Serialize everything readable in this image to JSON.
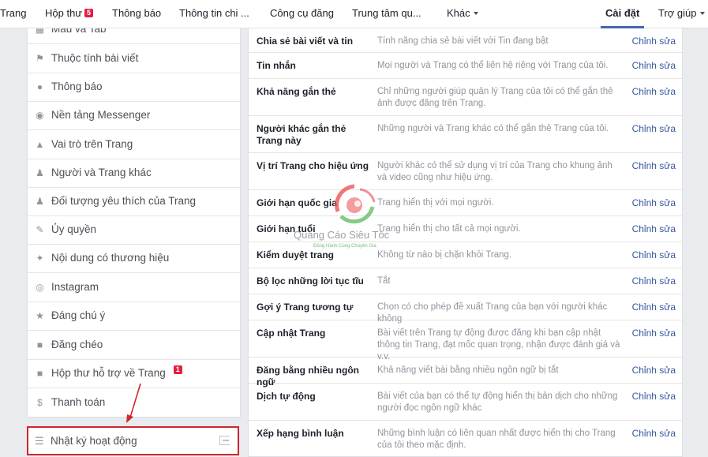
{
  "topnav": {
    "items": [
      {
        "label": "Trang"
      },
      {
        "label": "Hộp thư",
        "badge": "5"
      },
      {
        "label": "Thông báo"
      },
      {
        "label": "Thông tin chi ..."
      },
      {
        "label": "Công cụ đăng"
      },
      {
        "label": "Trung tâm qu..."
      },
      {
        "label": "Khác"
      },
      {
        "label": "Cài đặt"
      },
      {
        "label": "Trợ giúp"
      }
    ]
  },
  "sidebar": {
    "items": [
      {
        "label": "Mẫu và Tab",
        "icon": "grid-icon"
      },
      {
        "label": "Thuộc tính bài viết",
        "icon": "flag-icon"
      },
      {
        "label": "Thông báo",
        "icon": "globe-icon"
      },
      {
        "label": "Nền tảng Messenger",
        "icon": "messenger-icon"
      },
      {
        "label": "Vai trò trên Trang",
        "icon": "person-icon"
      },
      {
        "label": "Người và Trang khác",
        "icon": "people-star-icon"
      },
      {
        "label": "Đối tượng yêu thích của Trang",
        "icon": "people-star-icon"
      },
      {
        "label": "Ủy quyền",
        "icon": "wrench-icon"
      },
      {
        "label": "Nội dung có thương hiệu",
        "icon": "handshake-icon"
      },
      {
        "label": "Instagram",
        "icon": "instagram-icon"
      },
      {
        "label": "Đáng chú ý",
        "icon": "star-icon"
      },
      {
        "label": "Đăng chéo",
        "icon": "video-icon"
      },
      {
        "label": "Hộp thư hỗ trợ về Trang",
        "icon": "facebook-icon",
        "badge": "1"
      },
      {
        "label": "Thanh toán",
        "icon": "dollar-icon"
      }
    ],
    "activity_log": {
      "label": "Nhật ký hoạt động",
      "icon": "list-icon"
    }
  },
  "settings": {
    "edit_label": "Chỉnh sửa",
    "rows": [
      {
        "name": "Chia sẻ bài viết và tin",
        "desc": "Tính năng chia sẻ bài viết với Tin đang bật"
      },
      {
        "name": "Tin nhắn",
        "desc": "Mọi người và Trang có thể liên hệ riêng với Trang của tôi."
      },
      {
        "name": "Khả năng gắn thẻ",
        "desc": "Chỉ những người giúp quản lý Trang của tôi có thể gắn thẻ ảnh được đăng trên Trang."
      },
      {
        "name": "Người khác gắn thẻ Trang này",
        "desc": "Những người và Trang khác có thể gắn thẻ Trang của tôi."
      },
      {
        "name": "Vị trí Trang cho hiệu ứng",
        "desc": "Người khác có thể sử dụng vị trí của Trang cho khung ảnh và video cũng như hiệu ứng."
      },
      {
        "name": "Giới hạn quốc gia",
        "desc": "Trang hiển thị với mọi người."
      },
      {
        "name": "Giới hạn tuổi",
        "desc": "Trang hiển thị cho tất cả mọi người."
      },
      {
        "name": "Kiểm duyệt trang",
        "desc": "Không từ nào bị chặn khỏi Trang."
      },
      {
        "name": "Bộ lọc những lời tục tĩu",
        "desc": "Tắt"
      },
      {
        "name": "Gợi ý Trang tương tự",
        "desc": "Chọn có cho phép đề xuất Trang của bạn với người khác không"
      },
      {
        "name": "Cập nhật Trang",
        "desc": "Bài viết trên Trang tự động được đăng khi bạn cập nhật thông tin Trang, đạt mốc quan trọng, nhận được đánh giá và v.v."
      },
      {
        "name": "Đăng bằng nhiều ngôn ngữ",
        "desc": "Khả năng viết bài bằng nhiều ngôn ngữ bị tắt"
      },
      {
        "name": "Dịch tự động",
        "desc": "Bài viết của bạn có thể tự động hiển thị bản dịch cho những người đọc ngôn ngữ khác"
      },
      {
        "name": "Xếp hạng bình luận",
        "desc": "Những bình luận có liên quan nhất được hiển thị cho Trang của tôi theo mặc định."
      }
    ]
  },
  "watermark": {
    "text": "Quảng Cáo Siêu Tốc",
    "subtext": "Đồng Hành Cùng Chuyên Gia"
  },
  "colors": {
    "accent": "#4267b2",
    "link": "#365899",
    "highlight": "#d0262d",
    "badge": "#e41e3f"
  }
}
